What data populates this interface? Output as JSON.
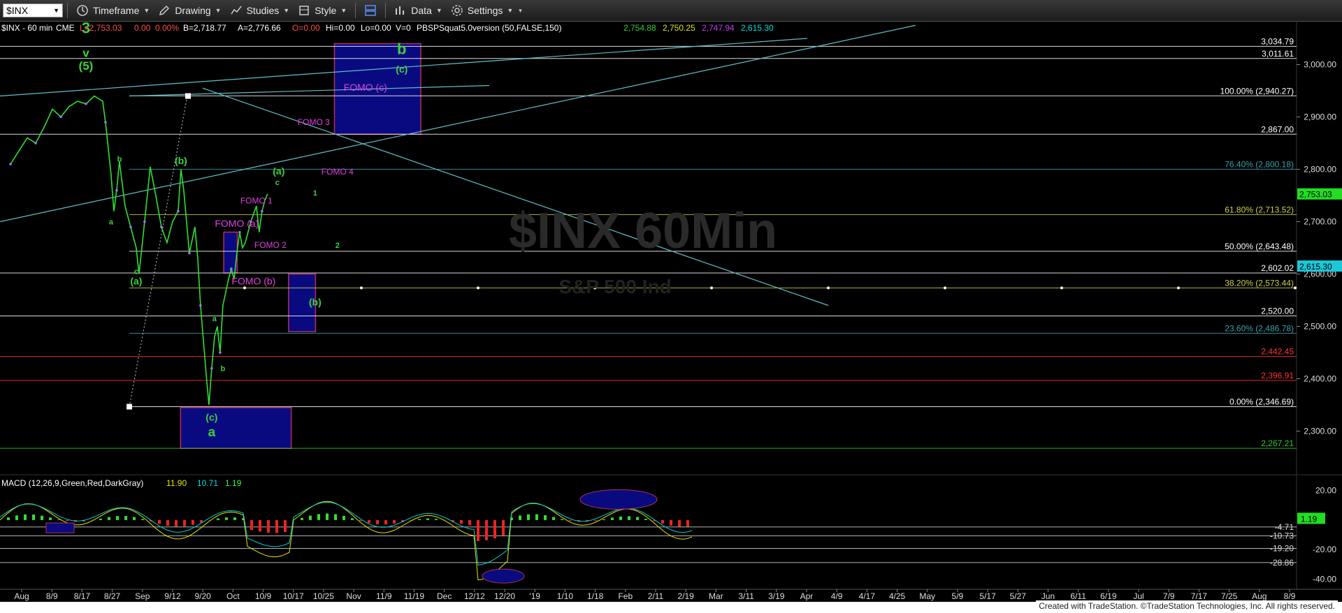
{
  "toolbar": {
    "symbol": "$INX",
    "timeframe_label": "Timeframe",
    "drawing_label": "Drawing",
    "studies_label": "Studies",
    "style_label": "Style",
    "data_label": "Data",
    "settings_label": "Settings"
  },
  "header": {
    "title": "$INX - 60 min",
    "exchange": "CME",
    "low": "L=2,753.03",
    "chg": "0.00",
    "pct": "0.00%",
    "bid": "B=2,718.77",
    "ask": "A=2,776.66",
    "open": "O=0.00",
    "hi": "Hi=0.00",
    "lo": "Lo=0.00",
    "vol": "V=0",
    "study": "PBSPSquat5.0version (50,FALSE,150)",
    "study_vals": [
      "2,754.88",
      "2,750.25",
      "2,747.94",
      "2,615.30"
    ]
  },
  "watermark": "$INX 60Min",
  "watermark_sub": "S&P 500 Ind",
  "footer": "Created with TradeStation. ©TradeStation Technologies, Inc. All rights reserved.",
  "chart_data": {
    "type": "line",
    "title": "$INX - 60 min",
    "ylim": [
      2230,
      3070
    ],
    "y_ticks": [
      "3,000.00",
      "2,900.00",
      "2,800.00",
      "2,700.00",
      "2,600.00",
      "2,500.00",
      "2,400.00",
      "2,300.00"
    ],
    "y_tick_values": [
      3000,
      2900,
      2800,
      2700,
      2600,
      2500,
      2400,
      2300
    ],
    "x_ticks": [
      "Aug",
      "8/9",
      "8/17",
      "8/27",
      "Sep",
      "9/12",
      "9/20",
      "Oct",
      "10/9",
      "10/17",
      "10/25",
      "Nov",
      "11/9",
      "11/19",
      "Dec",
      "12/12",
      "12/20",
      "'19",
      "1/10",
      "1/18",
      "Feb",
      "2/11",
      "2/19",
      "Mar",
      "3/11",
      "3/19",
      "Apr",
      "4/9",
      "4/17",
      "4/25",
      "May",
      "5/9",
      "5/17",
      "5/27",
      "Jun",
      "6/11",
      "6/19",
      "Jul",
      "7/9",
      "7/17",
      "7/25",
      "Aug",
      "8/9"
    ],
    "price_series": [
      [
        0,
        2810
      ],
      [
        3,
        2835
      ],
      [
        6,
        2860
      ],
      [
        9,
        2850
      ],
      [
        12,
        2880
      ],
      [
        15,
        2915
      ],
      [
        18,
        2900
      ],
      [
        21,
        2920
      ],
      [
        24,
        2930
      ],
      [
        27,
        2925
      ],
      [
        30,
        2940
      ],
      [
        33,
        2930
      ],
      [
        34,
        2890
      ],
      [
        36,
        2790
      ],
      [
        37,
        2720
      ],
      [
        38,
        2760
      ],
      [
        39,
        2815
      ],
      [
        41,
        2730
      ],
      [
        43,
        2690
      ],
      [
        45,
        2650
      ],
      [
        46,
        2600
      ],
      [
        48,
        2700
      ],
      [
        50,
        2805
      ],
      [
        52,
        2750
      ],
      [
        54,
        2690
      ],
      [
        56,
        2660
      ],
      [
        58,
        2700
      ],
      [
        60,
        2720
      ],
      [
        61,
        2800
      ],
      [
        62,
        2760
      ],
      [
        64,
        2640
      ],
      [
        66,
        2690
      ],
      [
        67,
        2630
      ],
      [
        68,
        2540
      ],
      [
        70,
        2410
      ],
      [
        71,
        2350
      ],
      [
        72,
        2420
      ],
      [
        73,
        2480
      ],
      [
        74,
        2500
      ],
      [
        75,
        2450
      ],
      [
        76,
        2540
      ],
      [
        78,
        2590
      ],
      [
        79,
        2610
      ],
      [
        80,
        2590
      ],
      [
        81,
        2640
      ],
      [
        82,
        2680
      ],
      [
        83,
        2650
      ],
      [
        84,
        2660
      ],
      [
        86,
        2700
      ],
      [
        88,
        2730
      ],
      [
        89,
        2680
      ],
      [
        90,
        2720
      ],
      [
        91,
        2740
      ],
      [
        92,
        2753
      ]
    ],
    "horizontal_levels": [
      {
        "label": "3,034.79",
        "value": 3034.79,
        "color": "#ffffff"
      },
      {
        "label": "3,011.61",
        "value": 3011.61,
        "color": "#ffffff"
      },
      {
        "label": "100.00% (2,940.27)",
        "value": 2940.27,
        "color": "#ffffff"
      },
      {
        "label": "2,867.00",
        "value": 2867.0,
        "color": "#ffffff"
      },
      {
        "label": "76.40% (2,800.18)",
        "value": 2800.18,
        "color": "#3aa0a8"
      },
      {
        "label": "61.80% (2,713.52)",
        "value": 2713.52,
        "color": "#cfcf4a"
      },
      {
        "label": "50.00% (2,643.48)",
        "value": 2643.48,
        "color": "#ffffff"
      },
      {
        "label": "2,602.02",
        "value": 2602.02,
        "color": "#ffffff"
      },
      {
        "label": "38.20% (2,573.44)",
        "value": 2573.44,
        "color": "#cfcf4a"
      },
      {
        "label": "2,520.00",
        "value": 2520.0,
        "color": "#ffffff"
      },
      {
        "label": "23.60% (2,486.78)",
        "value": 2486.78,
        "color": "#3aa0a8"
      },
      {
        "label": "2,442.45",
        "value": 2442.45,
        "color": "#ff3333"
      },
      {
        "label": "2,396.91",
        "value": 2396.91,
        "color": "#ff3333"
      },
      {
        "label": "0.00% (2,346.69)",
        "value": 2346.69,
        "color": "#ffffff"
      },
      {
        "label": "2,267.21",
        "value": 2267.21,
        "color": "#33cc33"
      }
    ],
    "price_tags": [
      {
        "label": "2,753.03",
        "value": 2753.03
      },
      {
        "label": "2,615.30",
        "value": 2615.3
      }
    ],
    "target_boxes": [
      {
        "name": "b-target",
        "x0": 120,
        "x1": 152,
        "y0": 2867,
        "y1": 3040
      },
      {
        "name": "fomo-a",
        "x0": 79,
        "x1": 84,
        "y0": 2602,
        "y1": 2680
      },
      {
        "name": "b-wave",
        "x0": 103,
        "x1": 113,
        "y0": 2490,
        "y1": 2600
      },
      {
        "name": "c-wave",
        "x0": 63,
        "x1": 104,
        "y0": 2267,
        "y1": 2345
      }
    ],
    "wave_labels": [
      {
        "text": "3",
        "x": 27,
        "y": 3060,
        "color": "#3cd23c",
        "size": 22
      },
      {
        "text": "v",
        "x": 27,
        "y": 3015,
        "color": "#3cd23c",
        "size": 17
      },
      {
        "text": "(5)",
        "x": 27,
        "y": 2990,
        "color": "#3cd23c",
        "size": 17
      },
      {
        "text": "b",
        "x": 39,
        "y": 2815,
        "color": "#3cd23c",
        "size": 11
      },
      {
        "text": "a",
        "x": 36,
        "y": 2695,
        "color": "#3cd23c",
        "size": 11
      },
      {
        "text": "c",
        "x": 45,
        "y": 2600,
        "color": "#3cd23c",
        "size": 11
      },
      {
        "text": "(a)",
        "x": 45,
        "y": 2580,
        "color": "#3cd23c",
        "size": 14
      },
      {
        "text": "(b)",
        "x": 61,
        "y": 2810,
        "color": "#3cd23c",
        "size": 14
      },
      {
        "text": "a",
        "x": 73,
        "y": 2510,
        "color": "#3cd23c",
        "size": 11
      },
      {
        "text": "b",
        "x": 76,
        "y": 2415,
        "color": "#3cd23c",
        "size": 11
      },
      {
        "text": "(c)",
        "x": 72,
        "y": 2320,
        "color": "#3cd23c",
        "size": 14
      },
      {
        "text": "a",
        "x": 72,
        "y": 2290,
        "color": "#3cd23c",
        "size": 19
      },
      {
        "text": "(a)",
        "x": 96,
        "y": 2790,
        "color": "#3cd23c",
        "size": 14
      },
      {
        "text": "c",
        "x": 95.5,
        "y": 2770,
        "color": "#3cd23c",
        "size": 11
      },
      {
        "text": "1",
        "x": 109,
        "y": 2750,
        "color": "#3cd23c",
        "size": 11
      },
      {
        "text": "2",
        "x": 117,
        "y": 2650,
        "color": "#3cd23c",
        "size": 11
      },
      {
        "text": "(b)",
        "x": 109,
        "y": 2540,
        "color": "#3cd23c",
        "size": 14
      },
      {
        "text": "b",
        "x": 140,
        "y": 3020,
        "color": "#3cd23c",
        "size": 22
      },
      {
        "text": "(c)",
        "x": 140,
        "y": 2985,
        "color": "#3cd23c",
        "size": 14
      }
    ],
    "fomo_labels": [
      {
        "text": "FOMO (c)",
        "x": 127,
        "y": 2950,
        "size": 14
      },
      {
        "text": "FOMO 3",
        "x": 108.5,
        "y": 2885,
        "size": 12
      },
      {
        "text": "FOMO 4",
        "x": 117,
        "y": 2790,
        "size": 12
      },
      {
        "text": "FOMO 1",
        "x": 88,
        "y": 2735,
        "size": 12
      },
      {
        "text": "FOMO (a)",
        "x": 81,
        "y": 2690,
        "size": 14
      },
      {
        "text": "FOMO 2",
        "x": 93,
        "y": 2650,
        "size": 12
      },
      {
        "text": "FOMO (b)",
        "x": 87,
        "y": 2580,
        "size": 14
      }
    ],
    "macd": {
      "label": "MACD (12,26,9,Green,Red,DarkGray)",
      "values": [
        "11.90",
        "10.71",
        "1.19"
      ],
      "value_colors": [
        "#e6e600",
        "#00e0e0",
        "#33ff33"
      ],
      "ylim": [
        -46,
        26
      ],
      "y_ticks": [
        "20.00",
        "-20.00",
        "-40.00"
      ],
      "y_tick_values": [
        20,
        -20,
        -40
      ],
      "levels": [
        {
          "label": "-4.71",
          "value": -4.71
        },
        {
          "label": "-10.73",
          "value": -10.73
        },
        {
          "label": "-19.20",
          "value": -19.2
        },
        {
          "label": "-28.86",
          "value": -28.86
        }
      ],
      "tag": "1.19",
      "tag_value": 1.19
    }
  }
}
